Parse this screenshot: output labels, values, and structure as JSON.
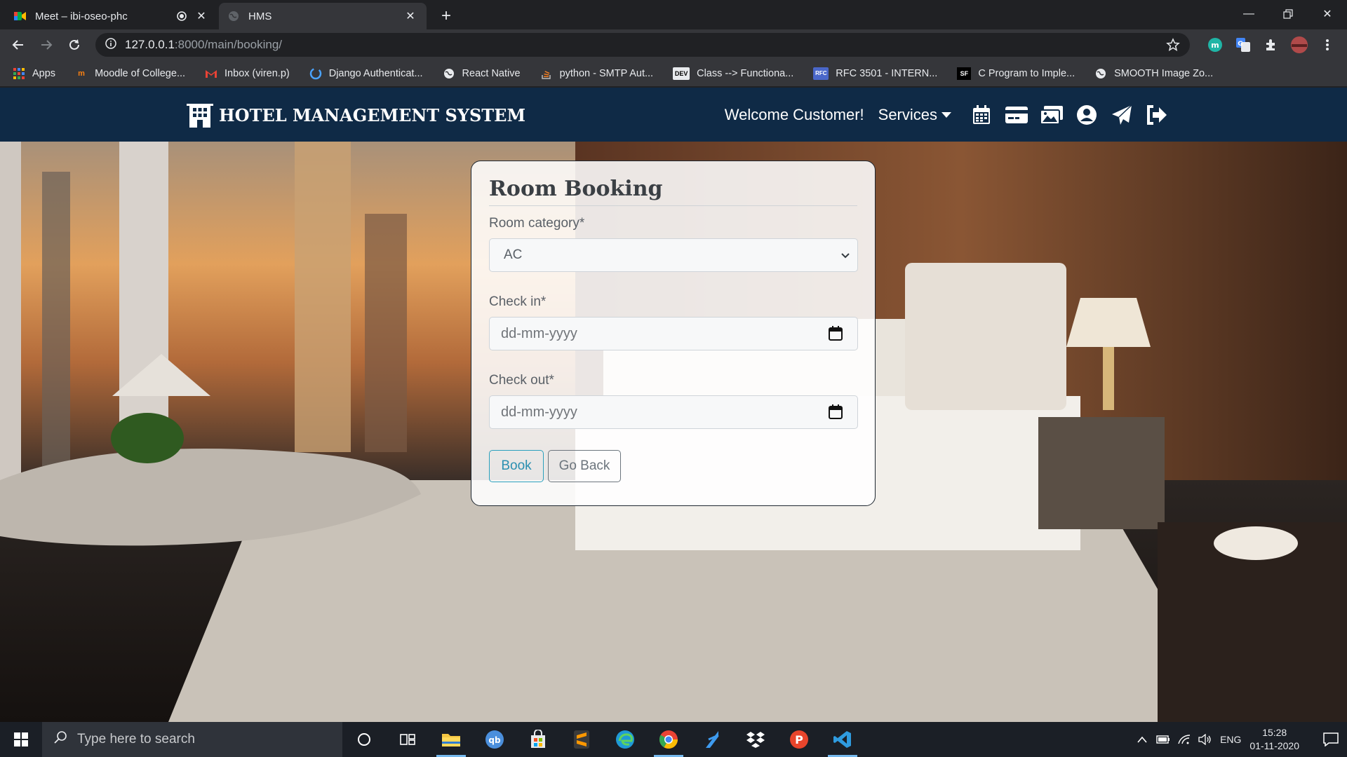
{
  "browser": {
    "tabs": [
      {
        "title": "Meet – ibi-oseo-phc",
        "active": false
      },
      {
        "title": "HMS",
        "active": true
      }
    ],
    "url_host": "127.0.0.1",
    "url_path": ":8000/main/booking/",
    "bookmarks": [
      {
        "label": "Apps",
        "icon": "apps-grid-icon"
      },
      {
        "label": "Moodle of College...",
        "icon": "moodle-icon"
      },
      {
        "label": "Inbox (viren.p)",
        "icon": "gmail-icon"
      },
      {
        "label": "Django Authenticat...",
        "icon": "django-icon"
      },
      {
        "label": "React Native",
        "icon": "globe-icon"
      },
      {
        "label": "python - SMTP Aut...",
        "icon": "stackoverflow-icon"
      },
      {
        "label": "Class --> Functiona...",
        "icon": "dev-icon",
        "badge": "DEV"
      },
      {
        "label": "RFC 3501 - INTERN...",
        "icon": "rfc-icon",
        "badge": "RFC"
      },
      {
        "label": "C Program to Imple...",
        "icon": "sf-icon",
        "badge": "SF"
      },
      {
        "label": "SMOOTH Image Zo...",
        "icon": "globe-icon"
      }
    ]
  },
  "navbar": {
    "brand": "HOTEL MANAGEMENT SYSTEM",
    "welcome": "Welcome Customer!",
    "services": "Services",
    "icons": [
      "calendar-icon",
      "credit-card-icon",
      "gallery-icon",
      "user-circle-icon",
      "send-icon",
      "sign-out-icon"
    ]
  },
  "booking": {
    "title": "Room Booking",
    "category_label": "Room category*",
    "category_value": "AC",
    "checkin_label": "Check in*",
    "checkin_placeholder": "dd-mm-yyyy",
    "checkout_label": "Check out*",
    "checkout_placeholder": "dd-mm-yyyy",
    "book_label": "Book",
    "back_label": "Go Back"
  },
  "taskbar": {
    "search_placeholder": "Type here to search",
    "apps": [
      "cortana-icon",
      "task-view-icon",
      "file-explorer-icon",
      "qbittorrent-icon",
      "store-icon",
      "sublime-icon",
      "edge-icon",
      "chrome-icon",
      "visual-studio-icon",
      "dropbox-icon",
      "postman-icon",
      "vscode-icon"
    ],
    "language": "ENG",
    "time": "15:28",
    "date": "01-11-2020"
  },
  "colors": {
    "navbar_bg": "#0f2a46",
    "book_button": "#2a8fb0",
    "back_button": "#6c757d"
  }
}
